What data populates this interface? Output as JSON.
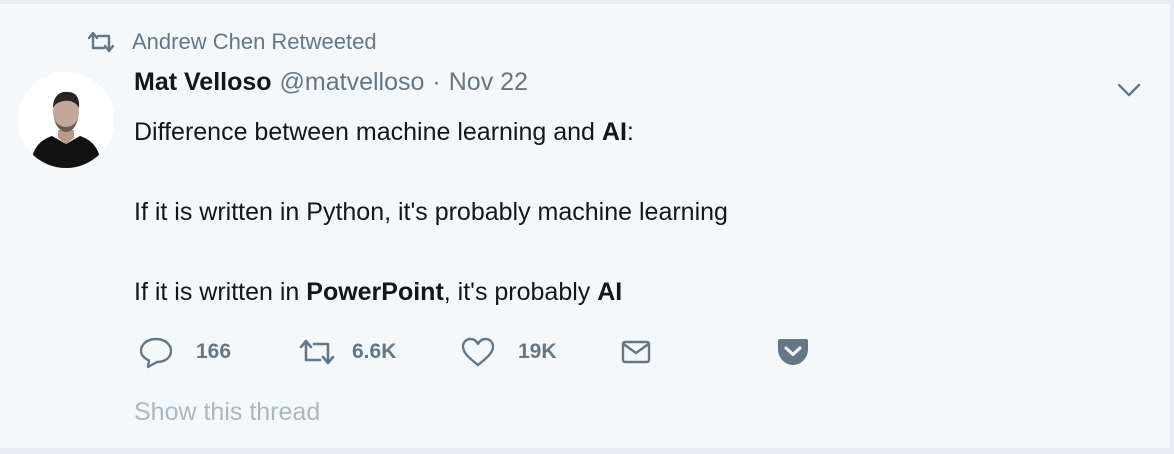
{
  "retweet_context": {
    "icon": "retweet-icon",
    "text": "Andrew Chen Retweeted"
  },
  "author": {
    "fullname": "Mat Velloso",
    "username": "@matvelloso",
    "separator": "·",
    "time": "Nov 22",
    "avatar": "profile-photo"
  },
  "tweet_text": {
    "line1": {
      "a": "Difference between machine learning and ",
      "b": "AI",
      "c": ":"
    },
    "line2": "If it is written in Python, it's probably machine learning",
    "line3": {
      "a": "If it is written in ",
      "b": "PowerPoint",
      "c": ", it's probably ",
      "d": "AI"
    }
  },
  "actions": {
    "reply": {
      "icon": "reply-icon",
      "count": "166"
    },
    "retweet": {
      "icon": "retweet-icon",
      "count": "6.6K"
    },
    "like": {
      "icon": "heart-icon",
      "count": "19K"
    },
    "dm": {
      "icon": "envelope-icon"
    },
    "pocket": {
      "icon": "pocket-icon"
    }
  },
  "show_thread": "Show this thread",
  "colors": {
    "background": "#f5f8fa",
    "outer": "#e6ecf0",
    "text": "#14171a",
    "secondary": "#657786",
    "muted": "#aab8c2"
  }
}
